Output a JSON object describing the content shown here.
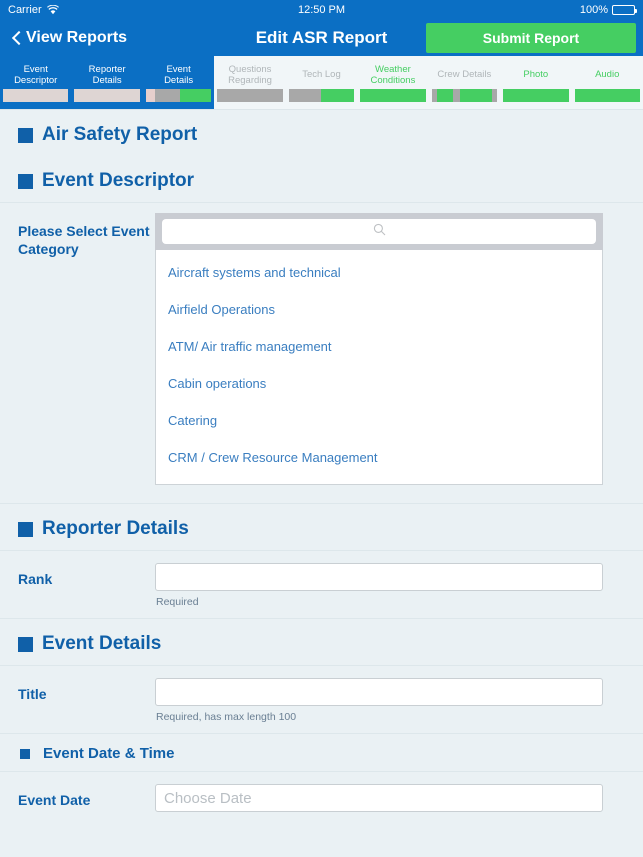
{
  "status_bar": {
    "carrier": "Carrier",
    "wifi_icon": "wifi-icon",
    "time": "12:50 PM",
    "battery_percent": "100%",
    "battery_icon": "battery-icon"
  },
  "nav": {
    "back_icon": "chevron-left-icon",
    "back_label": "View Reports",
    "title": "Edit ASR Report",
    "submit_label": "Submit Report"
  },
  "tabs": [
    {
      "label": "Event\nDescriptor",
      "selected": true,
      "label_color": "white",
      "segments": [
        {
          "color": "#ded5d3",
          "flex": 1
        }
      ]
    },
    {
      "label": "Reporter\nDetails",
      "selected": true,
      "label_color": "white",
      "segments": [
        {
          "color": "#ded5d3",
          "flex": 1
        }
      ]
    },
    {
      "label": "Event\nDetails",
      "selected": true,
      "label_color": "white",
      "segments": [
        {
          "color": "#e6cfcd",
          "flex": 0.14
        },
        {
          "color": "#a8a8a8",
          "flex": 0.38
        },
        {
          "color": "#45ce62",
          "flex": 0.48
        }
      ]
    },
    {
      "label": "Questions\nRegarding",
      "selected": false,
      "label_color": "gray",
      "segments": [
        {
          "color": "#a8a8a8",
          "flex": 1
        }
      ]
    },
    {
      "label": "Tech Log",
      "selected": false,
      "label_color": "gray",
      "segments": [
        {
          "color": "#a8a8a8",
          "flex": 0.5
        },
        {
          "color": "#45ce62",
          "flex": 0.5
        }
      ]
    },
    {
      "label": "Weather\nConditions",
      "selected": false,
      "label_color": "green",
      "segments": [
        {
          "color": "#45ce62",
          "flex": 1
        }
      ]
    },
    {
      "label": "Crew Details",
      "selected": false,
      "label_color": "gray",
      "segments": [
        {
          "color": "#a8a8a8",
          "flex": 0.08
        },
        {
          "color": "#45ce62",
          "flex": 0.25
        },
        {
          "color": "#a8a8a8",
          "flex": 0.1
        },
        {
          "color": "#45ce62",
          "flex": 0.49
        },
        {
          "color": "#a8a8a8",
          "flex": 0.08
        }
      ]
    },
    {
      "label": "Photo",
      "selected": false,
      "label_color": "green",
      "segments": [
        {
          "color": "#45ce62",
          "flex": 1
        }
      ]
    },
    {
      "label": "Audio",
      "selected": false,
      "label_color": "green",
      "segments": [
        {
          "color": "#45ce62",
          "flex": 1
        }
      ]
    }
  ],
  "page": {
    "report_title": "Air Safety Report"
  },
  "event_descriptor": {
    "heading": "Event Descriptor",
    "category_label": "Please Select\nEvent Category",
    "search_value": "",
    "search_placeholder": "",
    "search_icon": "search-icon",
    "options": [
      "Aircraft systems and technical",
      "Airfield Operations",
      "ATM/ Air traffic management",
      "Cabin operations",
      "Catering",
      "CRM / Crew Resource Management"
    ]
  },
  "reporter_details": {
    "heading": "Reporter Details",
    "rank_label": "Rank",
    "rank_value": "",
    "rank_placeholder": "",
    "rank_helper": "Required"
  },
  "event_details": {
    "heading": "Event Details",
    "title_label": "Title",
    "title_value": "",
    "title_placeholder": "",
    "title_helper": "Required, has max length 100"
  },
  "event_date_time": {
    "heading": "Event Date & Time",
    "date_label": "Event Date",
    "date_value": "",
    "date_placeholder": "Choose Date"
  },
  "colors": {
    "brand_blue": "#0b6fc4",
    "heading_blue": "#1060a8",
    "link_blue": "#3a7ec0",
    "green": "#45ce62",
    "page_bg": "#eaf1f4",
    "gray_segment": "#a8a8a8"
  }
}
